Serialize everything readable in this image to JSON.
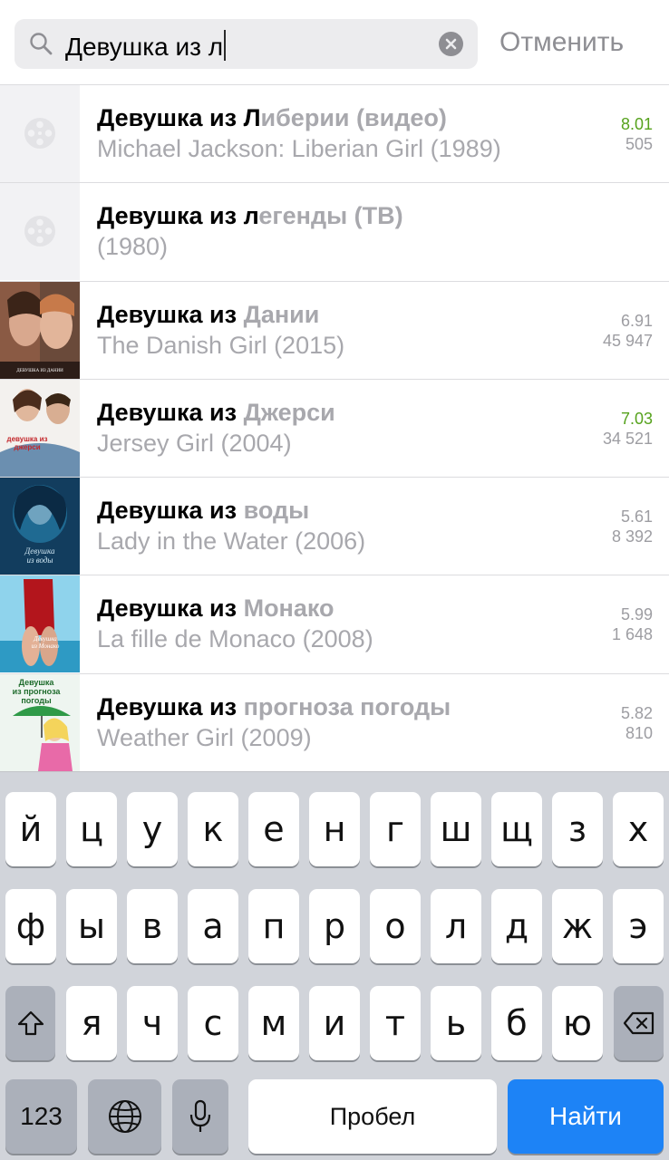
{
  "search": {
    "query": "Девушка из л",
    "cancel_label": "Отменить"
  },
  "results": [
    {
      "title_match": "Девушка из Л",
      "title_rest": "иберии (видео)",
      "subtitle": "Michael Jackson: Liberian Girl (1989)",
      "rating": "8.01",
      "votes": "505",
      "rating_good": true,
      "poster": "none"
    },
    {
      "title_match": "Девушка из л",
      "title_rest": "егенды (ТВ)",
      "subtitle": "(1980)",
      "rating": "",
      "votes": "",
      "rating_good": false,
      "poster": "none"
    },
    {
      "title_match": "Девушка из ",
      "title_rest": "Дании",
      "subtitle": "The Danish Girl (2015)",
      "rating": "6.91",
      "votes": "45 947",
      "rating_good": false,
      "poster": "danish"
    },
    {
      "title_match": "Девушка из ",
      "title_rest": "Джерси",
      "subtitle": "Jersey Girl (2004)",
      "rating": "7.03",
      "votes": "34 521",
      "rating_good": true,
      "poster": "jersey"
    },
    {
      "title_match": "Девушка из ",
      "title_rest": "воды",
      "subtitle": "Lady in the Water (2006)",
      "rating": "5.61",
      "votes": "8 392",
      "rating_good": false,
      "poster": "water"
    },
    {
      "title_match": "Девушка из ",
      "title_rest": "Монако",
      "subtitle": "La fille de Monaco (2008)",
      "rating": "5.99",
      "votes": "1 648",
      "rating_good": false,
      "poster": "monaco"
    },
    {
      "title_match": "Девушка из ",
      "title_rest": "прогноза погоды",
      "subtitle": "Weather Girl (2009)",
      "rating": "5.82",
      "votes": "810",
      "rating_good": false,
      "poster": "weather"
    }
  ],
  "posters": {
    "danish_text": "ДЕВУШКА ИЗ ДАНИИ",
    "jersey_text": "девушка из джерси",
    "water_text": "Девушка из воды",
    "monaco_text": "Девушка из Монако",
    "weather_text": "Девушка из прогноза погоды"
  },
  "keyboard": {
    "row1": [
      "й",
      "ц",
      "у",
      "к",
      "е",
      "н",
      "г",
      "ш",
      "щ",
      "з",
      "х"
    ],
    "row2": [
      "ф",
      "ы",
      "в",
      "а",
      "п",
      "р",
      "о",
      "л",
      "д",
      "ж",
      "э"
    ],
    "row3": [
      "я",
      "ч",
      "с",
      "м",
      "и",
      "т",
      "ь",
      "б",
      "ю"
    ],
    "numbers_label": "123",
    "space_label": "Пробел",
    "go_label": "Найти"
  },
  "colors": {
    "accent_blue": "#1d83f6",
    "rating_good": "#56a21d",
    "muted_text": "#a8a8ad"
  }
}
